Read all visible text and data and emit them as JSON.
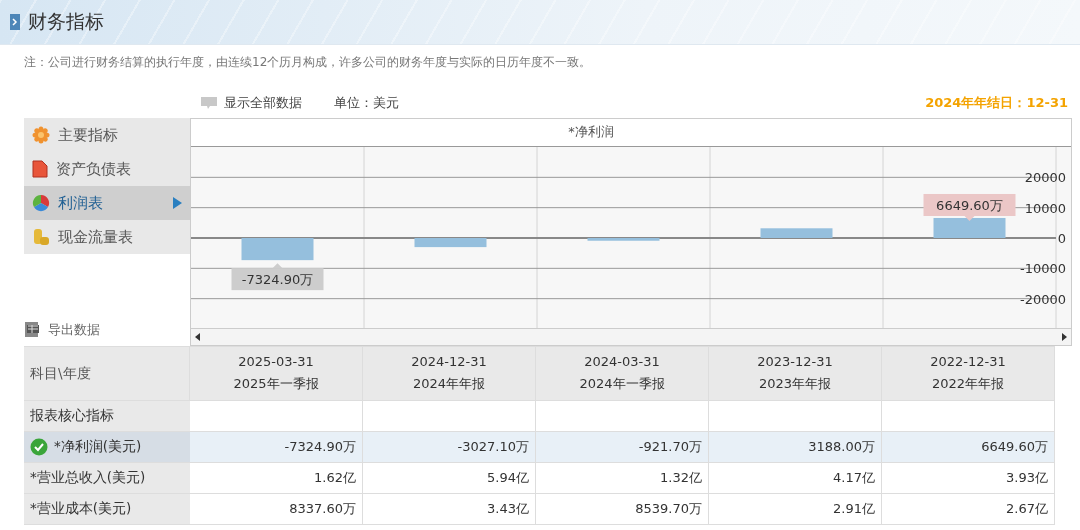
{
  "header": {
    "title": "财务指标"
  },
  "note": "注：公司进行财务结算的执行年度，由连续12个历月构成，许多公司的财务年度与实际的日历年度不一致。",
  "toolbar": {
    "show_all": "显示全部数据",
    "unit": "单位：美元",
    "year_end": "2024年年结日：12-31"
  },
  "sidebar": {
    "items": [
      {
        "label": "主要指标",
        "selected": false
      },
      {
        "label": "资产负债表",
        "selected": false
      },
      {
        "label": "利润表",
        "selected": true
      },
      {
        "label": "现金流量表",
        "selected": false
      }
    ],
    "export": "导出数据"
  },
  "chart": {
    "chart_data": {
      "type": "bar",
      "title": "*净利润",
      "values": [
        -7300,
        -3000,
        -900,
        3200,
        6600
      ],
      "ylim": [
        -30000,
        30000
      ],
      "yticks": [
        20000,
        10000,
        0,
        -10000,
        -20000
      ],
      "grid": true,
      "annotations": [
        {
          "y": -7300,
          "text": "-7324.90万"
        },
        {
          "y": 6600,
          "text": "6649.60万"
        }
      ]
    }
  },
  "table": {
    "corner": "科目\\年度",
    "columns": [
      {
        "date": "2025-03-31",
        "period": "2025年一季报"
      },
      {
        "date": "2024-12-31",
        "period": "2024年年报"
      },
      {
        "date": "2024-03-31",
        "period": "2024年一季报"
      },
      {
        "date": "2023-12-31",
        "period": "2023年年报"
      },
      {
        "date": "2022-12-31",
        "period": "2022年年报"
      }
    ],
    "rows": [
      {
        "label": "报表核心指标",
        "selected": false,
        "cells": []
      },
      {
        "label": "*净利润(美元)",
        "selected": true,
        "cells": [
          "-7324.90万",
          "-3027.10万",
          "-921.70万",
          "3188.00万",
          "6649.60万"
        ]
      },
      {
        "label": "*营业总收入(美元)",
        "selected": false,
        "cells": [
          "1.62亿",
          "5.94亿",
          "1.32亿",
          "4.17亿",
          "3.93亿"
        ]
      },
      {
        "label": "*营业成本(美元)",
        "selected": false,
        "cells": [
          "8337.60万",
          "3.43亿",
          "8539.70万",
          "2.91亿",
          "2.67亿"
        ]
      }
    ]
  }
}
